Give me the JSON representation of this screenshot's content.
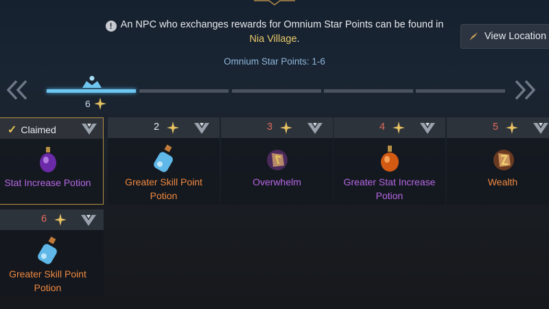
{
  "notice": {
    "text_before": "An NPC who exchanges rewards for Omnium Star Points can be found in",
    "village": "Nia Village",
    "period": ".",
    "range": "Omnium Star Points: 1-6"
  },
  "view_location_label": "View Location",
  "progress": {
    "current": "6",
    "fraction": 0.25
  },
  "claimed_label": "Claimed",
  "rewards": [
    {
      "number": "",
      "name_line1": "Stat Increase Potion",
      "name_line2": "",
      "grade": "epic",
      "icon": "purple-potion-icon",
      "claimed": true
    },
    {
      "number": "2",
      "name_line1": "Greater Skill Point",
      "name_line2": "Potion",
      "grade": "legendary",
      "icon": "blue-potion-icon",
      "claimed": false
    },
    {
      "number": "3",
      "name_line1": "Overwhelm",
      "name_line2": "",
      "grade": "epic",
      "icon": "rune-icon",
      "claimed": false
    },
    {
      "number": "4",
      "name_line1": "Greater Stat Increase",
      "name_line2": "Potion",
      "grade": "epic",
      "icon": "orange-potion-icon",
      "claimed": false
    },
    {
      "number": "5",
      "name_line1": "Wealth",
      "name_line2": "",
      "grade": "legendary",
      "icon": "rune-icon",
      "claimed": false
    },
    {
      "number": "6",
      "name_line1": "Greater Skill Point",
      "name_line2": "Potion",
      "grade": "legendary",
      "icon": "blue-potion-icon",
      "claimed": false
    }
  ],
  "colors": {
    "epic": "#b668e6",
    "legendary": "#f08a40",
    "progress": "#6fc6ef",
    "claimed_border": "#b29045"
  }
}
